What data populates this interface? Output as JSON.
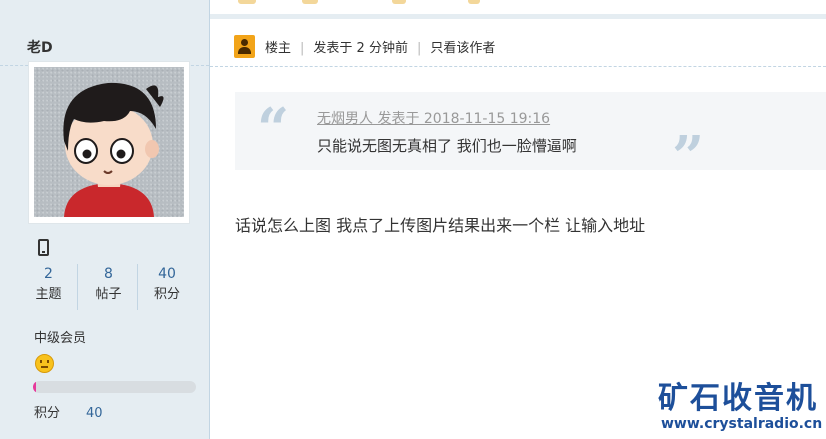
{
  "author": {
    "name": "老D",
    "stats": [
      {
        "value": "2",
        "label": "主题"
      },
      {
        "value": "8",
        "label": "帖子"
      },
      {
        "value": "40",
        "label": "积分"
      }
    ],
    "level": "中级会员",
    "level_progress_fraction": 0.01,
    "points_label": "积分",
    "points_value": "40"
  },
  "post_header": {
    "op_label": "楼主",
    "posted": "发表于 2 分钟前",
    "only_author": "只看该作者"
  },
  "quote": {
    "meta": "无烟男人 发表于 2018-11-15 19:16",
    "text": "只能说无图无真相了   我们也一脸懵逼啊",
    "open_mark": "“",
    "close_mark": "”"
  },
  "post_body": "话说怎么上图  我点了上传图片结果出来一个栏  让输入地址",
  "watermark": {
    "title": "矿石收音机",
    "url": "www.crystalradio.cn"
  },
  "colors": {
    "sidebar_bg": "#e5edf2",
    "link_blue": "#336699",
    "progress_pink": "#e6399b",
    "watermark_blue": "#1d4f9a"
  }
}
